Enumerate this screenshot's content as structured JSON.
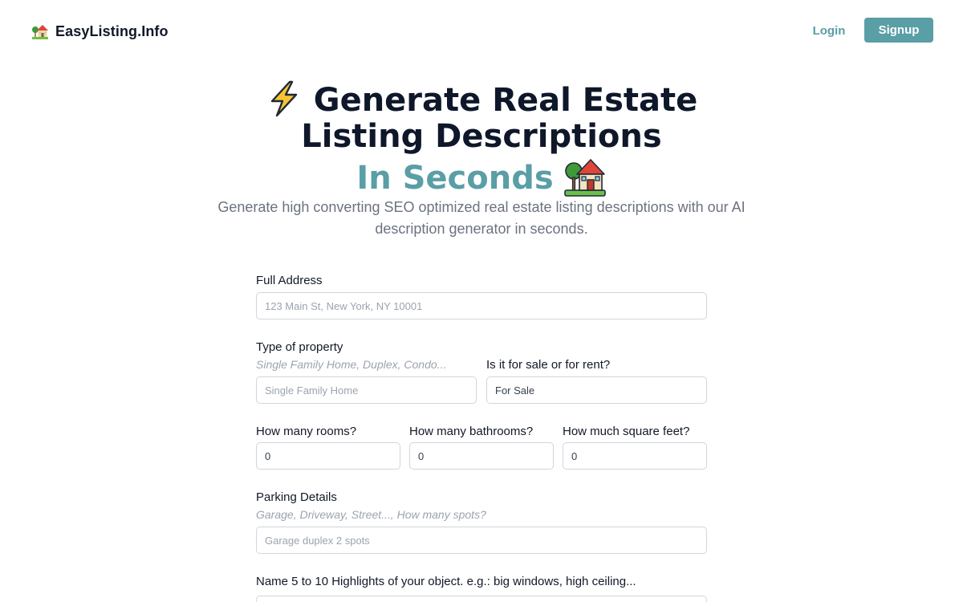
{
  "header": {
    "brand_name": "EasyListing.Info",
    "login_label": "Login",
    "signup_label": "Signup"
  },
  "hero": {
    "title_line1": "Generate Real Estate",
    "title_line2": "Listing Descriptions",
    "title_line3": "In Seconds",
    "subtitle": "Generate high converting SEO optimized real estate listing descriptions with our AI description generator in seconds."
  },
  "form": {
    "address": {
      "label": "Full Address",
      "placeholder": "123 Main St, New York, NY 10001"
    },
    "property_type": {
      "label": "Type of property",
      "hint": "Single Family Home, Duplex, Condo...",
      "placeholder": "Single Family Home"
    },
    "sale_rent": {
      "label": "Is it for sale or for rent?",
      "value": "For Sale"
    },
    "rooms": {
      "label": "How many rooms?",
      "value": "0"
    },
    "bathrooms": {
      "label": "How many bathrooms?",
      "value": "0"
    },
    "sqft": {
      "label": "How much square feet?",
      "value": "0"
    },
    "parking": {
      "label": "Parking Details",
      "hint": "Garage, Driveway, Street..., How many spots?",
      "placeholder": "Garage duplex 2 spots"
    },
    "highlights": {
      "label": "Name 5 to 10 Highlights of your object. e.g.: big windows, high ceiling..."
    }
  },
  "colors": {
    "accent": "#5a9ea6",
    "heading": "#0f172a",
    "muted": "#6b7280"
  },
  "icons": {
    "brand": "house-with-garden-icon",
    "title_left": "lightning-icon",
    "title_right": "house-with-garden-icon"
  }
}
